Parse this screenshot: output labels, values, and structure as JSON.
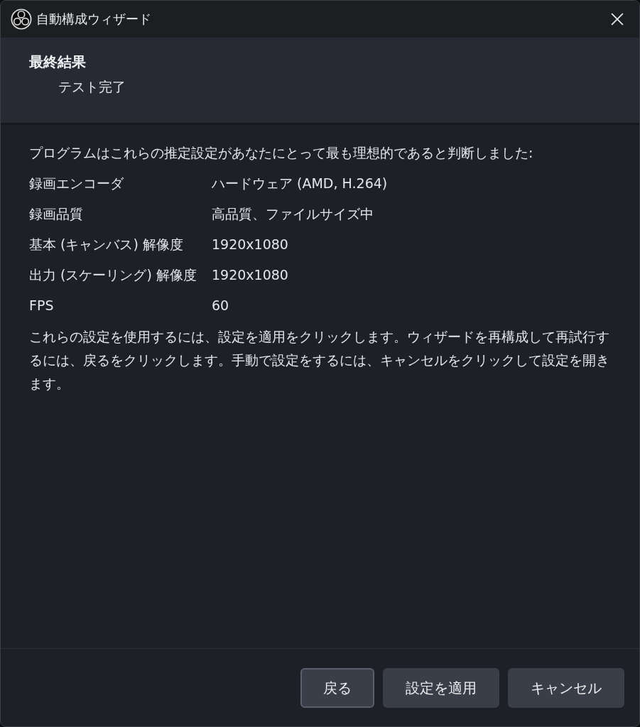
{
  "window": {
    "title": "自動構成ウィザード"
  },
  "header": {
    "title": "最終結果",
    "subtitle": "テスト完了"
  },
  "intro": "プログラムはこれらの推定設定があなたにとって最も理想的であると判断しました:",
  "settings": [
    {
      "label": "録画エンコーダ",
      "value": "ハードウェア (AMD, H.264)"
    },
    {
      "label": "録画品質",
      "value": "高品質、ファイルサイズ中"
    },
    {
      "label": "基本 (キャンバス) 解像度",
      "value": "1920x1080"
    },
    {
      "label": "出力 (スケーリング) 解像度",
      "value": "1920x1080"
    },
    {
      "label": "FPS",
      "value": "60"
    }
  ],
  "note": "これらの設定を使用するには、設定を適用をクリックします。ウィザードを再構成して再試行するには、戻るをクリックします。手動で設定をするには、キャンセルをクリックして設定を開きます。",
  "buttons": [
    {
      "label": "戻る",
      "focused": true
    },
    {
      "label": "設定を適用",
      "focused": false
    },
    {
      "label": "キャンセル",
      "focused": false
    }
  ]
}
